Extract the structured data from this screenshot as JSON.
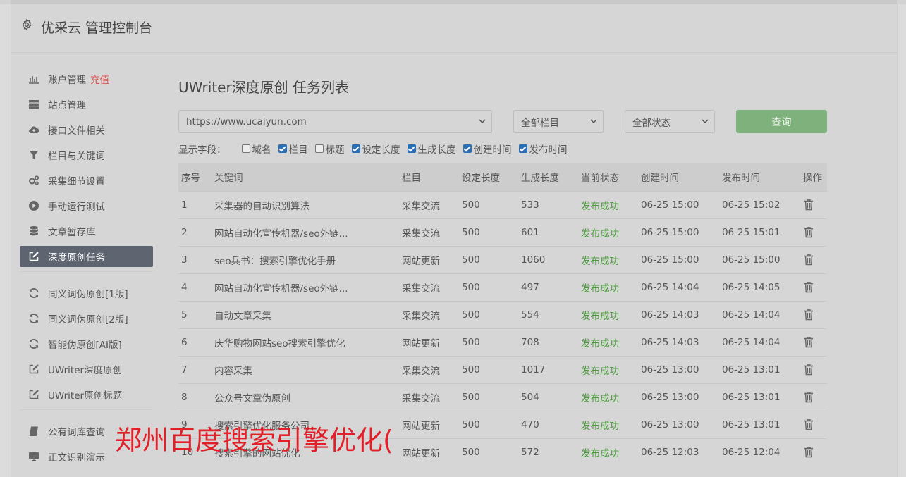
{
  "header": {
    "title": "优采云 管理控制台"
  },
  "sidebar": {
    "groups": [
      [
        {
          "key": "account",
          "icon": "bar-chart-icon",
          "label": "账户管理",
          "badge": "充值"
        },
        {
          "key": "sites",
          "icon": "server-icon",
          "label": "站点管理"
        },
        {
          "key": "api-files",
          "icon": "cloud-upload-icon",
          "label": "接口文件相关"
        },
        {
          "key": "columns",
          "icon": "filter-icon",
          "label": "栏目与关键词"
        },
        {
          "key": "collect-detail",
          "icon": "gears-icon",
          "label": "采集细节设置"
        },
        {
          "key": "manual-run",
          "icon": "play-circle-icon",
          "label": "手动运行测试"
        },
        {
          "key": "article-store",
          "icon": "database-icon",
          "label": "文章暂存库"
        },
        {
          "key": "deep-original",
          "icon": "edit-icon",
          "label": "深度原创任务",
          "active": true
        }
      ],
      [
        {
          "key": "synonym-1",
          "icon": "refresh-icon",
          "label": "同义词伪原创[1版]"
        },
        {
          "key": "synonym-2",
          "icon": "refresh-icon",
          "label": "同义词伪原创[2版]"
        },
        {
          "key": "ai-pseudo",
          "icon": "refresh-icon",
          "label": "智能伪原创[AI版]"
        },
        {
          "key": "uwriter-deep",
          "icon": "edit-icon",
          "label": "UWriter深度原创"
        },
        {
          "key": "uwriter-title",
          "icon": "edit-icon",
          "label": "UWriter原创标题"
        }
      ],
      [
        {
          "key": "public-lexicon",
          "icon": "book-icon",
          "label": "公有词库查询"
        },
        {
          "key": "text-recognition",
          "icon": "monitor-icon",
          "label": "正文识别演示"
        }
      ]
    ]
  },
  "main": {
    "title": "UWriter深度原创 任务列表",
    "filters": {
      "site": "https://www.ucaiyun.com",
      "column": "全部栏目",
      "status": "全部状态",
      "query_label": "查询"
    },
    "fields": {
      "label": "显示字段：",
      "items": [
        {
          "label": "域名",
          "checked": false
        },
        {
          "label": "栏目",
          "checked": true
        },
        {
          "label": "标题",
          "checked": false
        },
        {
          "label": "设定长度",
          "checked": true
        },
        {
          "label": "生成长度",
          "checked": true
        },
        {
          "label": "创建时间",
          "checked": true
        },
        {
          "label": "发布时间",
          "checked": true
        }
      ]
    },
    "table": {
      "columns": [
        "序号",
        "关键词",
        "栏目",
        "设定长度",
        "生成长度",
        "当前状态",
        "创建时间",
        "发布时间",
        "操作"
      ],
      "rows": [
        [
          "1",
          "采集器的自动识别算法",
          "采集交流",
          "500",
          "533",
          "发布成功",
          "06-25 15:00",
          "06-25 15:02"
        ],
        [
          "2",
          "网站自动化宣传机器/seo外链...",
          "采集交流",
          "500",
          "601",
          "发布成功",
          "06-25 15:00",
          "06-25 15:01"
        ],
        [
          "3",
          "seo兵书：搜索引擎优化手册",
          "网站更新",
          "500",
          "1060",
          "发布成功",
          "06-25 15:00",
          "06-25 15:00"
        ],
        [
          "4",
          "网站自动化宣传机器/seo外链...",
          "采集交流",
          "500",
          "497",
          "发布成功",
          "06-25 14:04",
          "06-25 14:05"
        ],
        [
          "5",
          "自动文章采集",
          "采集交流",
          "500",
          "554",
          "发布成功",
          "06-25 14:03",
          "06-25 14:04"
        ],
        [
          "6",
          "庆华购物网站seo搜索引擎优化",
          "网站更新",
          "500",
          "708",
          "发布成功",
          "06-25 14:03",
          "06-25 14:04"
        ],
        [
          "7",
          "内容采集",
          "采集交流",
          "500",
          "1017",
          "发布成功",
          "06-25 13:00",
          "06-25 13:01"
        ],
        [
          "8",
          "公众号文章伪原创",
          "采集交流",
          "500",
          "504",
          "发布成功",
          "06-25 13:00",
          "06-25 13:01"
        ],
        [
          "9",
          "搜索引擎优化服务公司",
          "网站更新",
          "500",
          "470",
          "发布成功",
          "06-25 13:00",
          "06-25 13:01"
        ],
        [
          "10",
          "搜索引擎的网站优化",
          "网站更新",
          "500",
          "572",
          "发布成功",
          "06-25 12:03",
          "06-25 12:04"
        ]
      ]
    }
  },
  "overlay": {
    "text": "郑州百度搜索引擎优化("
  }
}
